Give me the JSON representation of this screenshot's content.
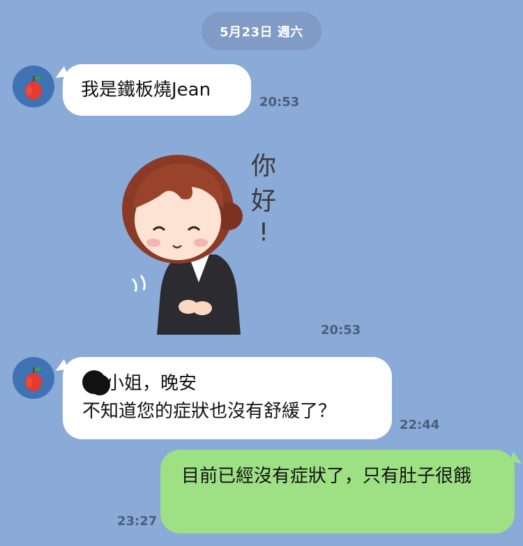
{
  "chat": {
    "date_separator": "5月23日 週六",
    "messages": [
      {
        "direction": "incoming",
        "sender_avatar": "apple-avatar",
        "text": "我是鐵板燒Jean",
        "time": "20:53"
      },
      {
        "direction": "incoming",
        "type": "sticker",
        "sticker_text": "你好！",
        "time": "20:53"
      },
      {
        "direction": "incoming",
        "sender_avatar": "apple-avatar",
        "line1": "小姐，晚安",
        "line2": "不知道您的症狀也沒有舒緩了？",
        "time": "22:44"
      },
      {
        "direction": "outgoing",
        "text": "目前已經沒有症狀了，只有肚子很餓",
        "time": "23:27"
      }
    ]
  },
  "colors": {
    "background": "#8aaad8",
    "incoming_bubble": "#ffffff",
    "outgoing_bubble": "#9ee184",
    "avatar_bg": "#3f73b4",
    "time_text": "#4d5d79"
  }
}
